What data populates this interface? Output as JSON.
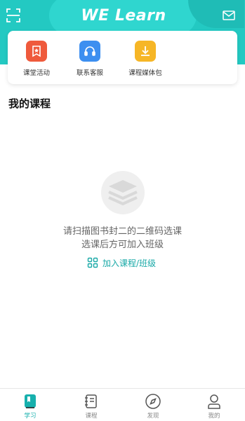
{
  "header": {
    "logo_text": "WE Learn",
    "brand_color": "#23c9c2"
  },
  "quick_actions": [
    {
      "label": "课堂活动",
      "icon": "classroom-activity-icon",
      "color": "#ef5a3c"
    },
    {
      "label": "联系客服",
      "icon": "headset-icon",
      "color": "#3d8ff0"
    },
    {
      "label": "课程媒体包",
      "icon": "download-icon",
      "color": "#f6b626"
    }
  ],
  "main": {
    "section_title": "我的课程",
    "empty_line1": "请扫描图书封二的二维码选课",
    "empty_line2": "选课后方可加入班级",
    "join_label": "加入课程/班级",
    "accent_color": "#1aa9a7"
  },
  "tabbar": {
    "tabs": [
      {
        "label": "学习",
        "icon": "study-icon",
        "active": true
      },
      {
        "label": "课程",
        "icon": "notebook-icon",
        "active": false
      },
      {
        "label": "发现",
        "icon": "compass-icon",
        "active": false
      },
      {
        "label": "我的",
        "icon": "profile-icon",
        "active": false
      }
    ]
  }
}
